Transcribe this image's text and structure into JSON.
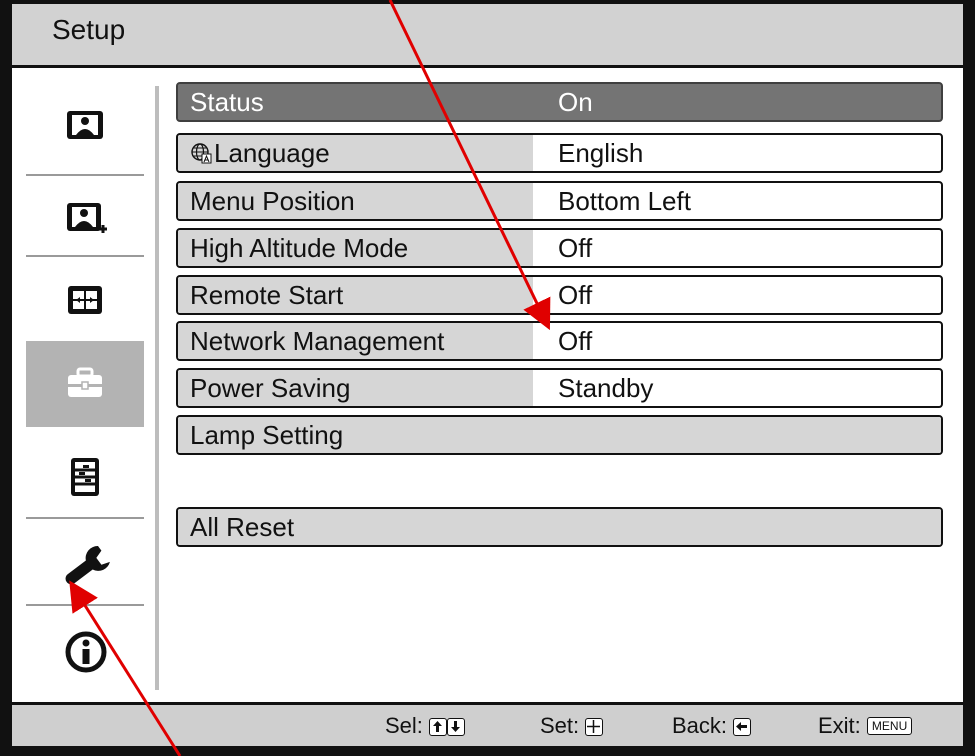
{
  "window": {
    "title": "Setup"
  },
  "sidebar": {
    "items": [
      {
        "icon": "picture-icon"
      },
      {
        "icon": "picture-plus-icon"
      },
      {
        "icon": "screen-icon"
      },
      {
        "icon": "toolbox-icon",
        "selected": true
      },
      {
        "icon": "function-icon"
      },
      {
        "icon": "wrench-icon"
      },
      {
        "icon": "info-icon"
      }
    ]
  },
  "menu": {
    "rows": [
      {
        "label": "Status",
        "value": "On"
      },
      {
        "label": "Language",
        "value": "English"
      },
      {
        "label": "Menu Position",
        "value": "Bottom Left"
      },
      {
        "label": "High Altitude Mode",
        "value": "Off"
      },
      {
        "label": "Remote Start",
        "value": "Off"
      },
      {
        "label": "Network Management",
        "value": "Off"
      },
      {
        "label": "Power Saving",
        "value": "Standby"
      },
      {
        "label": "Lamp Setting"
      },
      {
        "label": "All Reset"
      }
    ]
  },
  "footer": {
    "sel_label": "Sel:",
    "set_label": "Set:",
    "back_label": "Back:",
    "exit_label": "Exit:",
    "menu_key": "MENU"
  },
  "colors": {
    "highlight": "#747474",
    "label_bg": "#d6d6d6",
    "bar_bg": "#cfcfcf",
    "annotation_arrow": "#e00000"
  }
}
